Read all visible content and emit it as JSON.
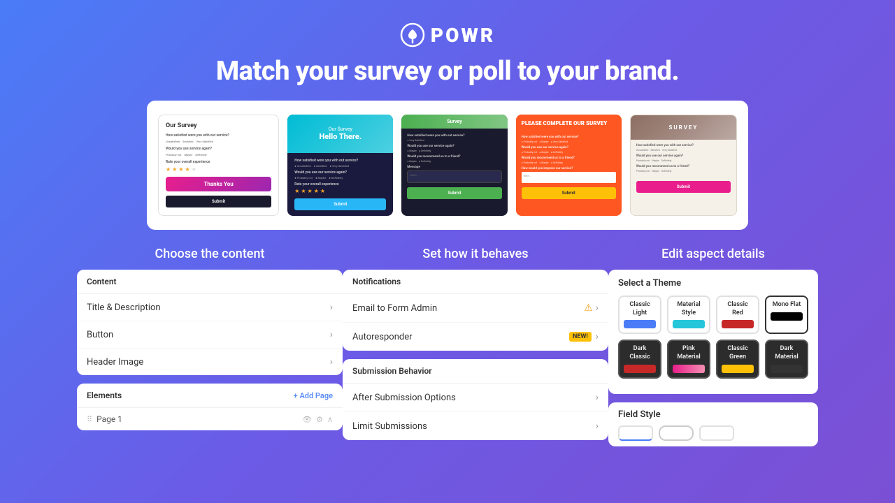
{
  "header": {
    "logo_text": "POWR",
    "headline": "Match your survey or poll to your brand."
  },
  "surveys": {
    "cards": [
      {
        "id": "card1",
        "title": "Our Survey",
        "question1": "How satisfied were you with out service?",
        "opts1": [
          "Unsatisfied",
          "Satisfied",
          "Very Satisfied"
        ],
        "question2": "Would you use service again?",
        "opts2": [
          "Probably not",
          "Maybe",
          "Definitely"
        ],
        "question3": "Rate your overall experience",
        "thanks_label": "Thanks You",
        "submit_label": "Submit"
      },
      {
        "id": "card2",
        "top_label": "Our Survey",
        "hello_label": "Hello There.",
        "question1": "How satisfied were you with out service?",
        "opts1": [
          "Unsatisfied",
          "Satisfied",
          "Very Satisfied"
        ],
        "question2": "Would you use our service again?",
        "opts2": [
          "Probably not",
          "Maybe",
          "Definitely"
        ],
        "question3": "Rate your overall experience",
        "submit_label": "Submit"
      },
      {
        "id": "card3",
        "top_label": "Survey",
        "question1": "How satisfied were you with out service?",
        "opts1": [
          "Very Satisfied"
        ],
        "question2": "Would you use our service again?",
        "opts2": [
          "Maybe",
          "Definitely"
        ],
        "question3": "Would you recommend us to a friend?",
        "opts3": [
          "Maybe",
          "Definitely"
        ],
        "message_label": "Message",
        "placeholder": "Hello...",
        "submit_label": "Submit"
      },
      {
        "id": "card4",
        "top_label": "PLEASE COMPLETE OUR SURVEY",
        "question1": "How satisfied were you with out service?",
        "opts1": [
          "Probably not",
          "Maybe",
          "Very Satisfied"
        ],
        "question2": "Would you use our service again?",
        "question3": "Would you recommend us to a friend?",
        "question4": "How would you improve our service?",
        "placeholder": "here...",
        "submit_label": "Submit"
      },
      {
        "id": "card5",
        "top_label": "SURVEY",
        "question1": "How satisfied were you with out service?",
        "opts1": [
          "Unsatisfied",
          "Satisfied",
          "Very Satisfied"
        ],
        "question2": "Would you use our service again?",
        "opts2": [
          "Probably not",
          "Maybe",
          "Definitely"
        ],
        "question3": "Would you recommend us to a friend?",
        "opts3": [
          "Probably not",
          "Maybe",
          "Definitely"
        ],
        "submit_label": "Submit"
      }
    ]
  },
  "sections": {
    "choose_content": {
      "title": "Choose the content",
      "content_panel": {
        "header": "Content",
        "items": [
          {
            "label": "Title & Description"
          },
          {
            "label": "Button"
          },
          {
            "label": "Header Image"
          }
        ]
      },
      "elements_panel": {
        "header": "Elements",
        "add_page_label": "+ Add Page",
        "page_label": "Page 1"
      }
    },
    "set_behavior": {
      "title": "Set how it behaves",
      "notifications_panel": {
        "header": "Notifications",
        "items": [
          {
            "label": "Email to Form Admin",
            "has_warning": true
          },
          {
            "label": "Autoresponder",
            "has_new": true,
            "new_label": "NEW!"
          }
        ]
      },
      "submission_behavior_panel": {
        "header": "Submission Behavior",
        "items": [
          {
            "label": "After Submission Options"
          },
          {
            "label": "Limit Submissions"
          }
        ]
      }
    },
    "edit_aspect": {
      "title": "Edit aspect details",
      "themes_panel": {
        "header": "Select a Theme",
        "themes": [
          {
            "id": "classic-light",
            "name": "Classic Light",
            "style": "classic-light-preview",
            "selected": false,
            "dark": false
          },
          {
            "id": "material-style",
            "name": "Material Style",
            "style": "material-style-preview",
            "selected": false,
            "dark": false
          },
          {
            "id": "classic-red",
            "name": "Classic Red",
            "style": "classic-red-preview",
            "selected": false,
            "dark": false
          },
          {
            "id": "mono-flat",
            "name": "Mono Flat",
            "style": "mono-flat-preview",
            "selected": true,
            "dark": false
          },
          {
            "id": "dark-classic",
            "name": "Dark Classic",
            "style": "dark-classic-preview",
            "selected": false,
            "dark": true
          },
          {
            "id": "pink-material",
            "name": "Pink Material",
            "style": "pink-material-preview",
            "selected": false,
            "dark": true
          },
          {
            "id": "classic-green",
            "name": "Classic Green",
            "style": "classic-green-preview",
            "selected": false,
            "dark": true
          },
          {
            "id": "dark-material",
            "name": "Dark Material",
            "style": "dark-material-preview",
            "selected": false,
            "dark": true
          }
        ]
      },
      "field_style_panel": {
        "header": "Field Style"
      }
    }
  }
}
